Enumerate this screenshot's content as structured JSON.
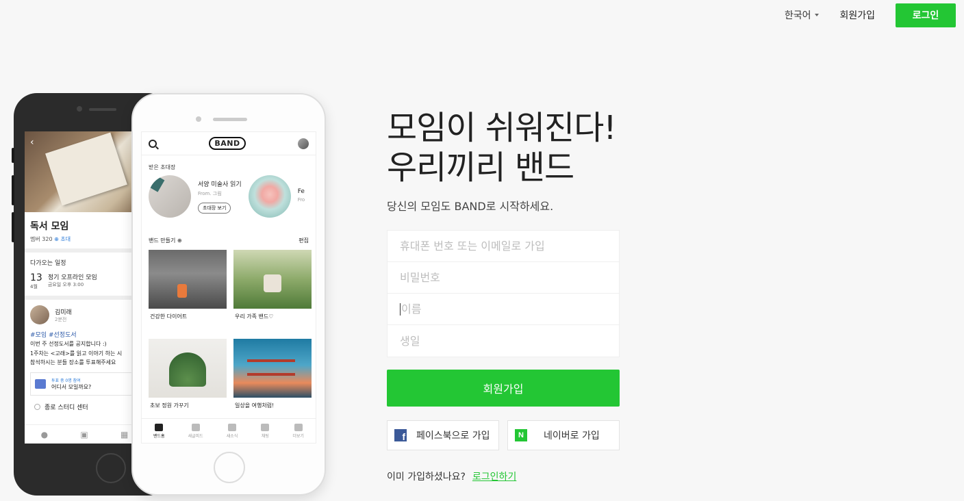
{
  "header": {
    "language": "한국어",
    "signup_label": "회원가입",
    "login_label": "로그인"
  },
  "hero": {
    "headline_line1": "모임이 쉬워진다!",
    "headline_line2": "우리끼리 밴드",
    "subtitle": "당신의 모임도 BAND로 시작하세요."
  },
  "form": {
    "phone_email_placeholder": "휴대폰 번호 또는 이메일로 가입",
    "password_placeholder": "비밀번호",
    "name_placeholder": "이름",
    "birthday_placeholder": "생일",
    "submit_label": "회원가입",
    "facebook_label": "페이스북으로 가입",
    "naver_label": "네이버로 가입",
    "already_text": "이미 가입하셨나요?",
    "login_link": "로그인하기"
  },
  "phone_dark": {
    "band_title": "독서 모임",
    "member_count": "멤버 320",
    "invite": "⊕ 초대",
    "upcoming_label": "다가오는 일정",
    "event_day": "13",
    "event_month": "4월",
    "event_name": "정기 오프라인 모임",
    "event_time": "금요일 오후 3:00",
    "post_author": "김미래",
    "post_time": "2분전",
    "post_tags": "#모임 #선정도서",
    "post_line1": "이번 주 선정도서를 공지합니다 :)",
    "post_line2": "1주차는 <고래>를 읽고 이야기 하는 시",
    "post_line3": "참석하시는 분들 장소를 투표해주세요",
    "poll_status": "투표 중  0명 참여",
    "poll_question": "어디서 모일까요?",
    "poll_option": "종로 스터디 센터"
  },
  "phone_white": {
    "logo": "BAND",
    "invites_label": "받은 초대장",
    "invite1_title": "서양 미술사 읽기",
    "invite1_from": "From. 그림",
    "invite_button": "초대장 보기",
    "invite2_title": "Fe",
    "invite2_from": "Fro",
    "make_band": "밴드 만들기 ⊕",
    "edit": "편집",
    "cards": [
      {
        "caption": "건강한 다이어트"
      },
      {
        "caption": "우리 가족 밴드♡"
      },
      {
        "caption": "초보 정원 가꾸기"
      },
      {
        "caption": "일상을 여행처럼!"
      }
    ],
    "tabs": [
      {
        "label": "밴드홈"
      },
      {
        "label": "새글피드"
      },
      {
        "label": "새소식"
      },
      {
        "label": "채팅"
      },
      {
        "label": "더보기"
      }
    ]
  },
  "colors": {
    "accent": "#23c634",
    "facebook": "#3b5998",
    "background": "#f7f7f7"
  }
}
